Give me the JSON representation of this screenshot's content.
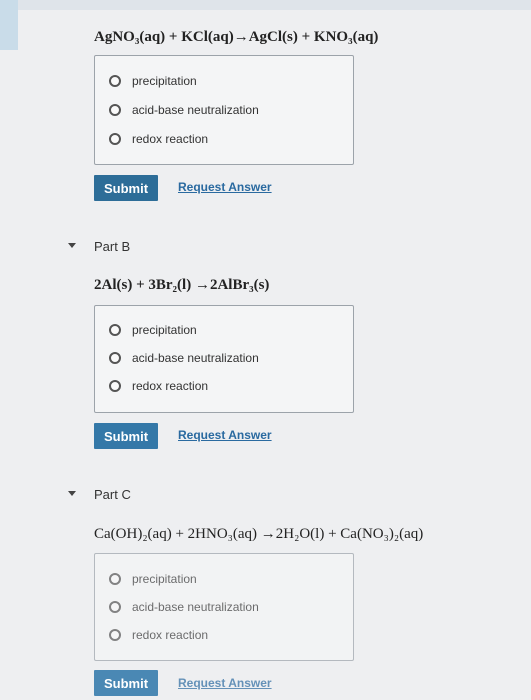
{
  "part_a": {
    "equation": "AgNO₃(aq) + KCl(aq)→AgCl(s) + KNO₃(aq)",
    "options": [
      "precipitation",
      "acid-base neutralization",
      "redox reaction"
    ],
    "submit": "Submit",
    "request": "Request Answer"
  },
  "part_b": {
    "title": "Part B",
    "equation": "2Al(s) + 3Br₂(l) →2AlBr₃(s)",
    "options": [
      "precipitation",
      "acid-base neutralization",
      "redox reaction"
    ],
    "submit": "Submit",
    "request": "Request Answer"
  },
  "part_c": {
    "title": "Part C",
    "equation": "Ca(OH)₂(aq) + 2HNO₃(aq) →2H₂O(l) + Ca(NO₃)₂(aq)",
    "options": [
      "precipitation",
      "acid-base neutralization",
      "redox reaction"
    ],
    "submit": "Submit",
    "request": "Request Answer"
  }
}
